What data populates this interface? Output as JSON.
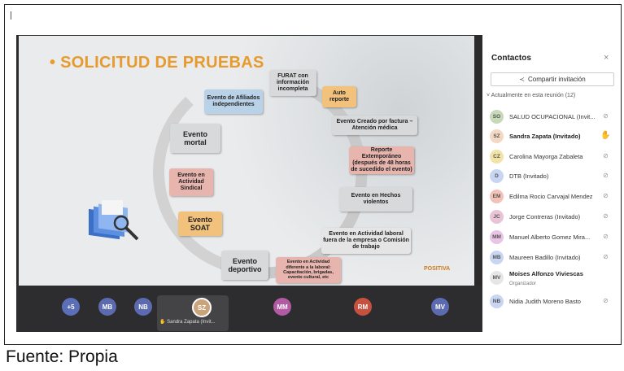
{
  "caption": "Fuente: Propia",
  "slide": {
    "title": "• SOLICITUD DE PRUEBAS",
    "boxes": {
      "furat": "FURAT con información incompleta",
      "auto": "Auto reporte",
      "afiliados": "Evento de Afiliados independientes",
      "factura": "Evento Creado por factura – Atención médica",
      "mortal": "Evento mortal",
      "extemporaneo": "Reporte Extemporáneo (después de 48 horas de sucedido el evento)",
      "sindical": "Evento en Actividad Sindical",
      "violentos": "Evento en Hechos violentos",
      "soat": "Evento SOAT",
      "laboral": "Evento en Actividad laboral fuera de la empresa o Comisión de trabajo",
      "deportivo": "Evento deportivo",
      "diferente": "Evento en Actividad diferente a la laboral: Capacitación, brigadas, evento cultural, etc"
    },
    "logo": "POSITIVA"
  },
  "bottombar": {
    "avatars": [
      "+5",
      "MB",
      "NB",
      "SZ",
      "MM",
      "RM",
      "MV"
    ],
    "speaker_label": "Sandra Zapata (Invit..."
  },
  "panel": {
    "title": "Contactos",
    "close": "×",
    "share_label": "Compartir invitación",
    "section": "Actualmente en esta reunión (12)",
    "participants": [
      {
        "initials": "SO",
        "name": "SALUD OCUPACIONAL (Invit...",
        "color": "#c7d9b8"
      },
      {
        "initials": "SZ",
        "name": "Sandra Zapata (Invitado)",
        "color": "#f3d9c4"
      },
      {
        "initials": "CZ",
        "name": "Carolina Mayorga Zabaleta",
        "color": "#f3e3a6"
      },
      {
        "initials": "D",
        "name": "DTB (Invitado)",
        "color": "#c9d6f2"
      },
      {
        "initials": "EM",
        "name": "Edilma Rocio Carvajal Mendez",
        "color": "#f2c2b8"
      },
      {
        "initials": "JC",
        "name": "Jorge Contreras (Invitado)",
        "color": "#e9c4d6"
      },
      {
        "initials": "MM",
        "name": "Manuel Alberto Gomez Mira...",
        "color": "#e9c4e6"
      },
      {
        "initials": "MB",
        "name": "Maureen Badillo (Invitado)",
        "color": "#c9d6f2"
      },
      {
        "initials": "MV",
        "name": "Moises Alfonzo Viviescas",
        "sub": "Organizador",
        "color": "#e6e6e6"
      },
      {
        "initials": "NB",
        "name": "Nidia Judith Moreno Basto",
        "color": "#c9d6f2"
      }
    ]
  }
}
